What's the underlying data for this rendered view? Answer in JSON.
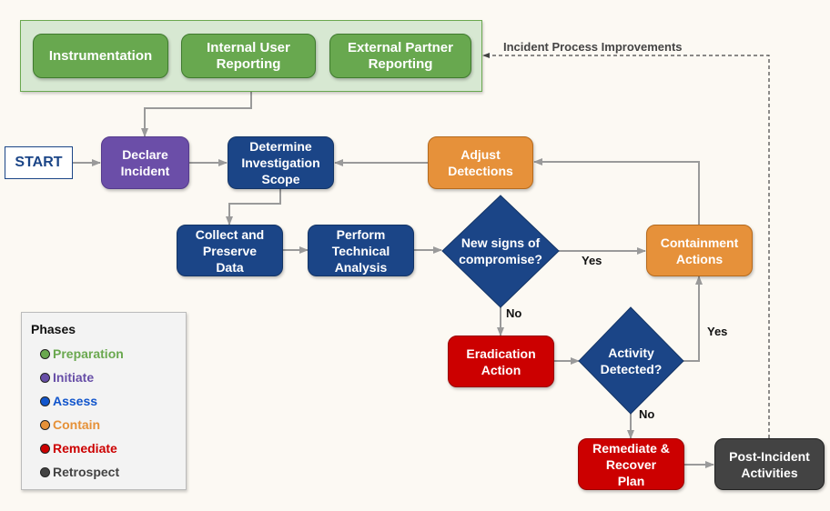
{
  "diagram": {
    "preparation_group": {
      "nodes": [
        "Instrumentation",
        "Internal User\nReporting",
        "External Partner\nReporting"
      ]
    },
    "start_label": "START",
    "nodes": {
      "declare_incident": "Declare\nIncident",
      "determine_scope": "Determine\nInvestigation\nScope",
      "adjust_detections": "Adjust\nDetections",
      "collect_preserve": "Collect and\nPreserve\nData",
      "technical_analysis": "Perform\nTechnical\nAnalysis",
      "new_signs_decision": "New signs of\ncompromise?",
      "containment_actions": "Containment\nActions",
      "eradication_action": "Eradication\nAction",
      "activity_detected_decision": "Activity\nDetected?",
      "remediate_recover": "Remediate &\nRecover\nPlan",
      "post_incident": "Post-Incident\nActivities"
    },
    "edge_labels": {
      "new_signs_yes": "Yes",
      "new_signs_no": "No",
      "activity_yes": "Yes",
      "activity_no": "No",
      "improvements": "Incident Process Improvements"
    },
    "legend": {
      "title": "Phases",
      "items": [
        {
          "label": "Preparation",
          "color": "#6aa84f"
        },
        {
          "label": "Initiate",
          "color": "#674ea7"
        },
        {
          "label": "Assess",
          "color": "#1155cc"
        },
        {
          "label": "Contain",
          "color": "#e69138"
        },
        {
          "label": "Remediate",
          "color": "#cc0000"
        },
        {
          "label": "Retrospect",
          "color": "#434343"
        }
      ]
    }
  }
}
